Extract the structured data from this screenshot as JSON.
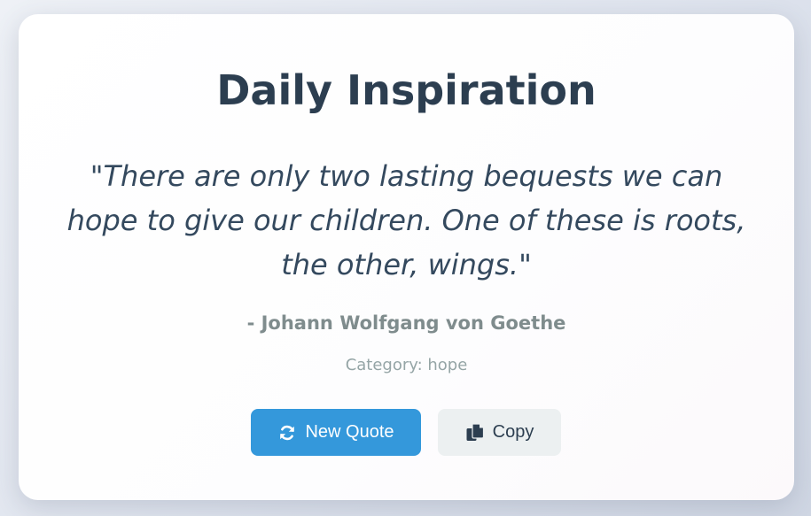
{
  "card": {
    "title": "Daily Inspiration",
    "quote_text": "\"There are only two lasting bequests we can hope to give our children. One of these is roots, the other, wings.\"",
    "author": "- Johann Wolfgang von Goethe",
    "category": "Category: hope"
  },
  "buttons": {
    "new_quote": {
      "label": "New Quote",
      "icon": "refresh-icon",
      "color": "#3498db"
    },
    "copy": {
      "label": "Copy",
      "icon": "copy-icon",
      "color": "#ecf0f1"
    }
  },
  "colors": {
    "title": "#2c3e50",
    "quote": "#34495e",
    "author": "#7f8c8d",
    "category": "#95a5a6"
  }
}
